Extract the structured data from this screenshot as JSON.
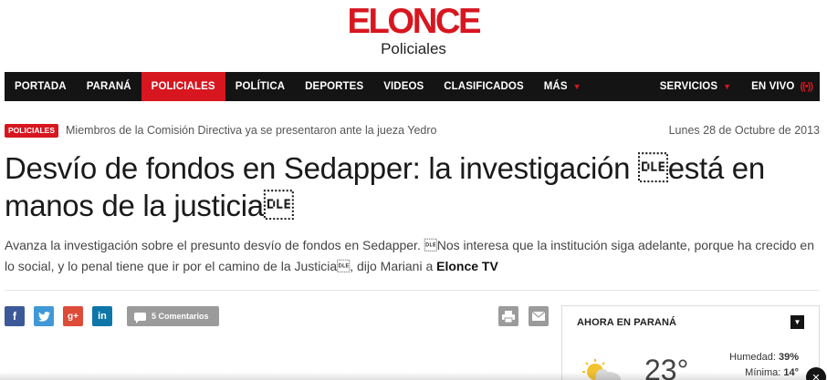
{
  "brand": {
    "logo": "ELONCE",
    "section": "Policiales"
  },
  "nav": {
    "items": [
      {
        "label": "PORTADA"
      },
      {
        "label": "PARANÁ"
      },
      {
        "label": "POLICIALES",
        "active": true
      },
      {
        "label": "POLÍTICA"
      },
      {
        "label": "DEPORTES"
      },
      {
        "label": "VIDEOS"
      },
      {
        "label": "CLASIFICADOS"
      },
      {
        "label": "MÁS"
      }
    ],
    "right": [
      {
        "label": "SERVICIOS"
      },
      {
        "label": "EN VIVO"
      }
    ]
  },
  "article": {
    "badge": "POLICIALES",
    "related_link": "Miembros de la Comisión Directiva ya se presentaron ante la jueza Yedro",
    "date": "Lunes 28 de Octubre de 2013",
    "headline": "Desvío de fondos en Sedapper: la investigación \u0010está en manos de la justicia\u0010",
    "lead": "Avanza la investigación sobre el presunto desvío de fondos en Sedapper. \u0010Nos interesa que la institución siga adelante, porque ha crecido en lo social, y lo penal tiene que ir por el camino de la Justicia\u0010, dijo Mariani a ",
    "lead_source": "Elonce TV"
  },
  "share": {
    "facebook": "f",
    "twitter": "t",
    "googleplus": "g+",
    "linkedin": "in",
    "comments": "5 Comentarios"
  },
  "widget": {
    "title": "AHORA EN PARANÁ",
    "temperature": "23°",
    "humidity_label": "Humedad:",
    "humidity_value": "39%",
    "min_label": "Mínima:",
    "min_value": "14°"
  },
  "colors": {
    "brand_red": "#d7161f",
    "nav_bg": "#141414",
    "facebook": "#3b5998",
    "twitter": "#4099d6",
    "googleplus": "#dd4b39",
    "linkedin": "#0e76a8"
  }
}
